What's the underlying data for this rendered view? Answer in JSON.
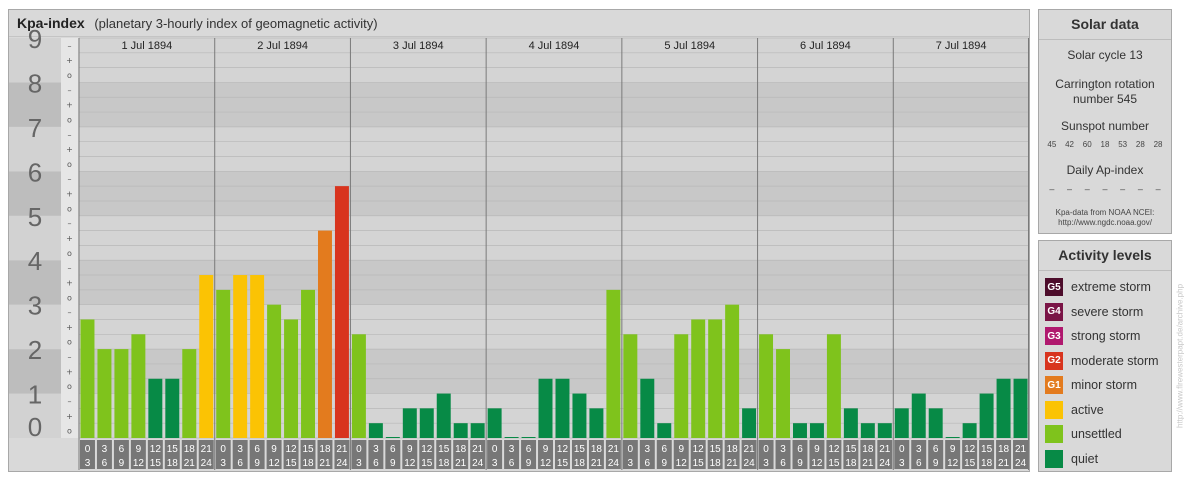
{
  "header": {
    "title": "Kpa-index",
    "subtitle": "(planetary 3-hourly index of geomagnetic activity)"
  },
  "chart_data": {
    "type": "bar",
    "ylim": [
      0,
      9
    ],
    "y_ticks": [
      "0",
      "1",
      "2",
      "3",
      "4",
      "5",
      "6",
      "7",
      "8",
      "9"
    ],
    "sub_ticks": [
      "–",
      "o",
      "+"
    ],
    "days": [
      "1 Jul 1894",
      "2 Jul 1894",
      "3 Jul 1894",
      "4 Jul 1894",
      "5 Jul 1894",
      "6 Jul 1894",
      "7 Jul 1894"
    ],
    "interval_labels": [
      [
        "0",
        "3"
      ],
      [
        "3",
        "6"
      ],
      [
        "6",
        "9"
      ],
      [
        "9",
        "12"
      ],
      [
        "12",
        "15"
      ],
      [
        "15",
        "18"
      ],
      [
        "18",
        "21"
      ],
      [
        "21",
        "24"
      ]
    ],
    "values": [
      [
        2.667,
        2.0,
        2.0,
        2.333,
        1.333,
        1.333,
        2.0,
        3.667
      ],
      [
        3.333,
        3.667,
        3.667,
        3.0,
        2.667,
        3.333,
        4.667,
        5.667
      ],
      [
        2.333,
        0.333,
        0.0,
        0.667,
        0.667,
        1.0,
        0.333,
        0.333
      ],
      [
        0.667,
        0.0,
        0.0,
        1.333,
        1.333,
        1.0,
        0.667,
        3.333
      ],
      [
        2.333,
        1.333,
        0.333,
        2.333,
        2.667,
        2.667,
        3.0,
        0.667
      ],
      [
        2.333,
        2.0,
        0.333,
        0.333,
        2.333,
        0.667,
        0.333,
        0.333
      ],
      [
        0.667,
        1.0,
        0.667,
        0.0,
        0.333,
        1.0,
        1.333,
        1.333
      ]
    ]
  },
  "solar": {
    "heading": "Solar data",
    "cycle": "Solar cycle 13",
    "rotation_line1": "Carrington rotation",
    "rotation_line2": "number 545",
    "sunspot_heading": "Sunspot number",
    "sunspot_values": [
      "45",
      "42",
      "60",
      "18",
      "53",
      "28",
      "28"
    ],
    "ap_heading": "Daily Ap-index",
    "ap_values": [
      "–",
      "–",
      "–",
      "–",
      "–",
      "–",
      "–"
    ],
    "source_line1": "Kpa-data from NOAA NCEI:",
    "source_line2": "http://www.ngdc.noaa.gov/"
  },
  "activity": {
    "heading": "Activity levels",
    "levels": [
      {
        "badge": "G5",
        "label": "extreme storm",
        "color": "#4d0d2b"
      },
      {
        "badge": "G4",
        "label": "severe storm",
        "color": "#7a1446"
      },
      {
        "badge": "G3",
        "label": "strong storm",
        "color": "#b0186e"
      },
      {
        "badge": "G2",
        "label": "moderate storm",
        "color": "#d8341e"
      },
      {
        "badge": "G1",
        "label": "minor storm",
        "color": "#e37b1e"
      },
      {
        "badge": "",
        "label": "active",
        "color": "#fbc304"
      },
      {
        "badge": "",
        "label": "unsettled",
        "color": "#7fc31c"
      },
      {
        "badge": "",
        "label": "quiet",
        "color": "#078a46"
      }
    ]
  },
  "watermark": "http://www.flrewesterpapt.de/archive.php",
  "colors": {
    "quiet": "#078a46",
    "unsettled": "#7fc31c",
    "active": "#fbc304",
    "minor_storm": "#e37b1e",
    "moderate_storm": "#d8341e",
    "band_dark": "#c6c6c6",
    "band_light": "#dcdcdc",
    "tick_box": "#777777"
  }
}
